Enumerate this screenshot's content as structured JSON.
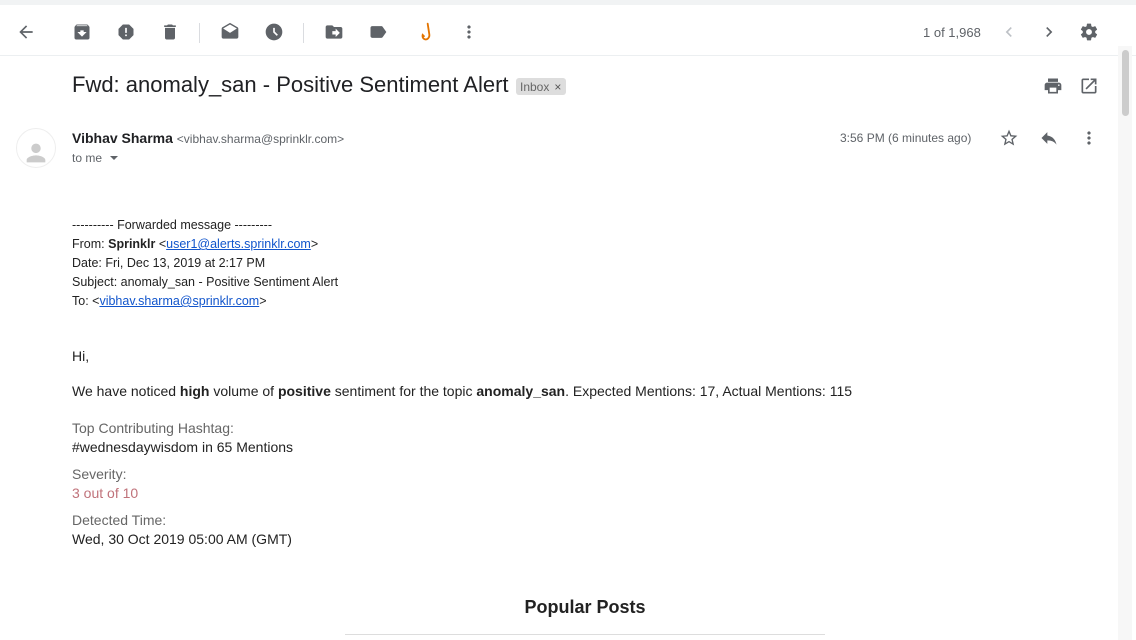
{
  "toolbar": {
    "back_icon": "arrow-back-icon",
    "archive_icon": "archive-icon",
    "spam_icon": "report-spam-icon",
    "delete_icon": "delete-icon",
    "mark_unread_icon": "mark-unread-icon",
    "snooze_icon": "snooze-clock-icon",
    "move_icon": "move-to-icon",
    "label_icon": "label-icon",
    "addon_icon": "fishhook-addon-icon",
    "more_icon": "more-vert-icon",
    "pager_text": "1 of 1,968",
    "settings_icon": "gear-icon"
  },
  "email": {
    "subject": "Fwd: anomaly_san - Positive Sentiment Alert",
    "label": "Inbox",
    "label_close": "×",
    "sender_name": "Vibhav Sharma",
    "sender_email": "<vibhav.sharma@sprinklr.com>",
    "to_line": "to me",
    "timestamp": "3:56 PM (6 minutes ago)"
  },
  "forwarded": {
    "divider": "---------- Forwarded message ---------",
    "from_prefix": "From: ",
    "from_name": "Sprinklr",
    "from_lt": " <",
    "from_email": "user1@alerts.sprinklr.com",
    "from_gt": ">",
    "date": "Date: Fri, Dec 13, 2019 at 2:17 PM",
    "subject": "Subject: anomaly_san - Positive Sentiment Alert",
    "to_prefix": "To: <",
    "to_email": "vibhav.sharma@sprinklr.com",
    "to_gt": ">"
  },
  "message": {
    "greeting": "Hi,",
    "t1": "We have noticed ",
    "b1": "high",
    "t2": " volume of ",
    "b2": "positive",
    "t3": " sentiment for the topic ",
    "b3": "anomaly_san",
    "t4": ". Expected Mentions: 17, Actual Mentions: 115",
    "hashtag_label": "Top Contributing Hashtag:",
    "hashtag_value": "#wednesdaywisdom in 65 Mentions",
    "severity_label": "Severity:",
    "severity_value": "3 out of 10",
    "detected_label": "Detected Time:",
    "detected_value": "Wed, 30 Oct 2019 05:00 AM (GMT)",
    "popular_title": "Popular Posts"
  },
  "colors": {
    "severity": "#c0727a",
    "link": "#1155cc",
    "addon_accent": "#e37400"
  }
}
